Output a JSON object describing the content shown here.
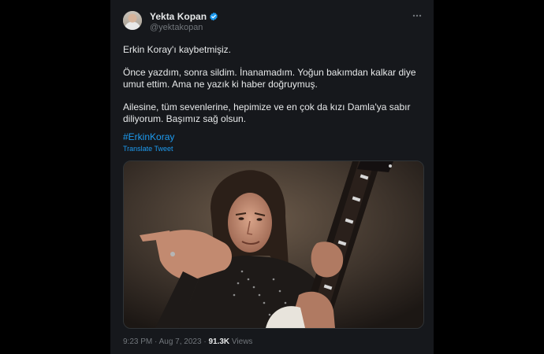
{
  "user": {
    "name": "Yekta Kopan",
    "handle": "@yektakopan"
  },
  "tweet": {
    "line1": "Erkin Koray'ı kaybetmişiz.",
    "para2": "Önce yazdım, sonra sildim. İnanamadım. Yoğun bakımdan kalkar diye umut ettim. Ama ne yazık ki haber doğruymuş.",
    "para3": "Ailesine, tüm sevenlerine, hepimize ve en çok da kızı Damla'ya sabır diliyorum. Başımız sağ olsun.",
    "hashtag": "#ErkinKoray",
    "translate_label": "Translate Tweet"
  },
  "meta": {
    "time": "9:23 PM",
    "separator": "·",
    "date": "Aug 7, 2023",
    "views_count": "91.3K",
    "views_label": "Views"
  },
  "icons": {
    "verified": "verified-badge-icon",
    "more": "more-options-icon"
  },
  "colors": {
    "background": "#000000",
    "card": "#16181c",
    "text": "#e7e9ea",
    "muted": "#71767b",
    "link": "#1d9bf0"
  }
}
